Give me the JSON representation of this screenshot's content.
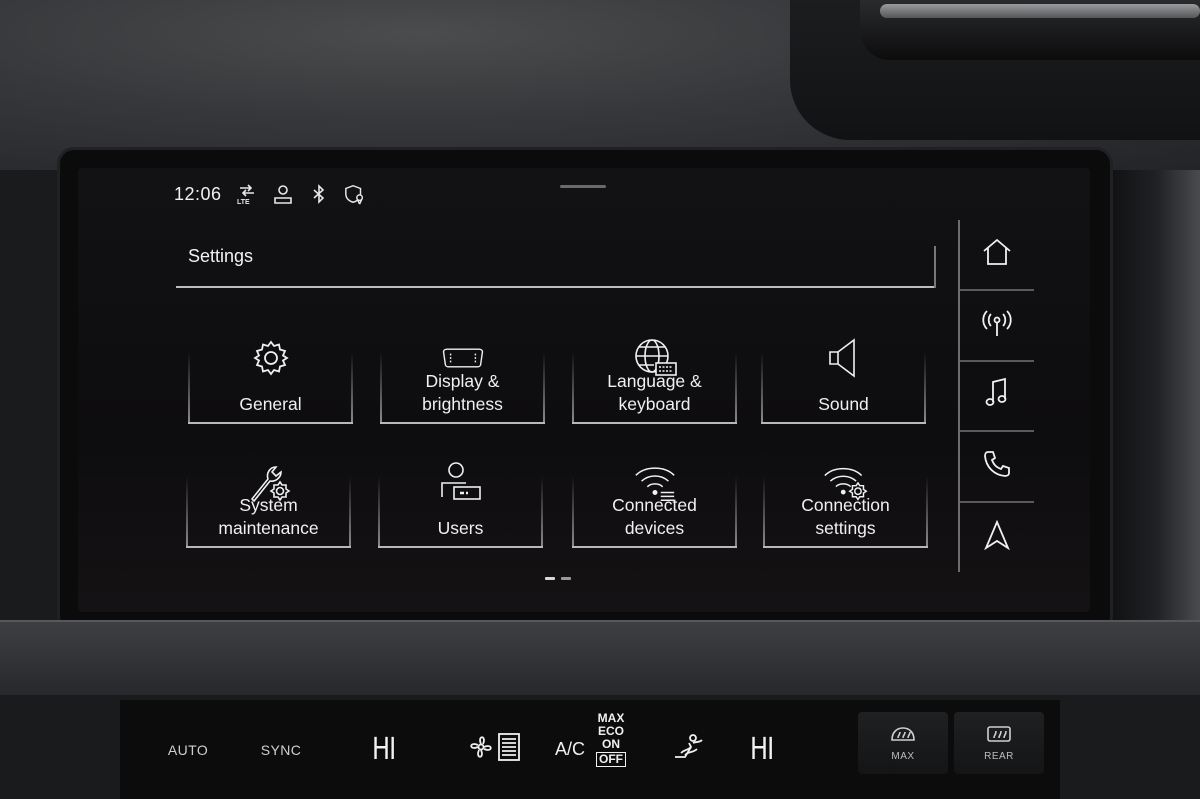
{
  "status_bar": {
    "time": "12:06",
    "icons": [
      "lte-signal-icon",
      "user-icon",
      "bluetooth-icon",
      "location-privacy-icon"
    ]
  },
  "page": {
    "title": "Settings"
  },
  "tiles": [
    {
      "label": "General",
      "icon": "gear-icon"
    },
    {
      "label": "Display & brightness",
      "icon": "display-icon"
    },
    {
      "label": "Language & keyboard",
      "icon": "globe-keyboard-icon"
    },
    {
      "label": "Sound",
      "icon": "speaker-icon"
    },
    {
      "label": "System maintenance",
      "icon": "wrench-gear-icon"
    },
    {
      "label": "Users",
      "icon": "users-icon"
    },
    {
      "label": "Connected devices",
      "icon": "wifi-list-icon"
    },
    {
      "label": "Connection settings",
      "icon": "wifi-gear-icon"
    }
  ],
  "nav_rail": [
    "home-icon",
    "radio-icon",
    "music-icon",
    "phone-icon",
    "navigation-icon"
  ],
  "climate": {
    "auto": "AUTO",
    "sync": "SYNC",
    "temp_left": "HI",
    "ac": "A/C",
    "max": "MAX",
    "eco": "ECO",
    "on": "ON",
    "off": "OFF",
    "temp_right": "HI",
    "defrost_front": "MAX",
    "defrost_rear": "REAR"
  },
  "colors": {
    "screen_bg": "#0d0c0e",
    "text": "#f0f0f0",
    "rule": "#b8b8b8"
  }
}
